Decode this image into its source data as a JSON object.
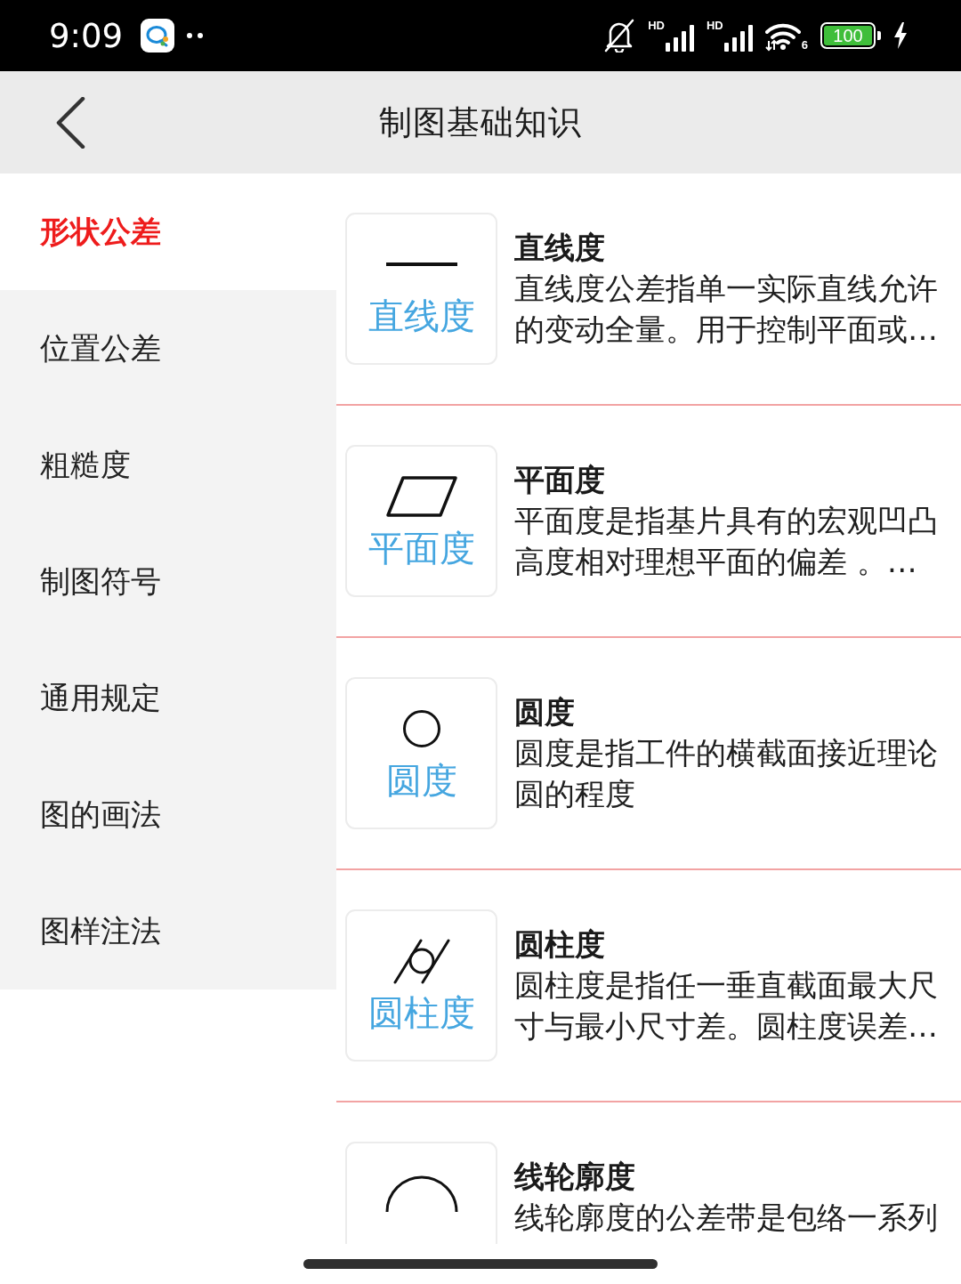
{
  "status_bar": {
    "time": "9:09",
    "network_labels": [
      "HD",
      "HD"
    ],
    "wifi_label": "6",
    "battery": "100"
  },
  "header": {
    "title": "制图基础知识"
  },
  "sidebar": {
    "items": [
      {
        "label": "形状公差",
        "selected": true
      },
      {
        "label": "位置公差",
        "selected": false
      },
      {
        "label": "粗糙度",
        "selected": false
      },
      {
        "label": "制图符号",
        "selected": false
      },
      {
        "label": "通用规定",
        "selected": false
      },
      {
        "label": "图的画法",
        "selected": false
      },
      {
        "label": "图样注法",
        "selected": false
      }
    ]
  },
  "topics": [
    {
      "kind": "straightness",
      "symbol_label": "直线度",
      "title": "直线度",
      "description": "直线度公差指单一实际直线允许的变动全量。用于控制平面或…"
    },
    {
      "kind": "flatness",
      "symbol_label": "平面度",
      "title": "平面度",
      "description": "平面度是指基片具有的宏观凹凸高度相对理想平面的偏差 。…"
    },
    {
      "kind": "roundness",
      "symbol_label": "圆度",
      "title": "圆度",
      "description": "圆度是指工件的横截面接近理论圆的程度"
    },
    {
      "kind": "cylindricity",
      "symbol_label": "圆柱度",
      "title": "圆柱度",
      "description": "圆柱度是指任一垂直截面最大尺寸与最小尺寸差。圆柱度误差…"
    },
    {
      "kind": "line_profile",
      "title": "线轮廓度",
      "description": "线轮廓度的公差带是包络一系列"
    }
  ]
}
